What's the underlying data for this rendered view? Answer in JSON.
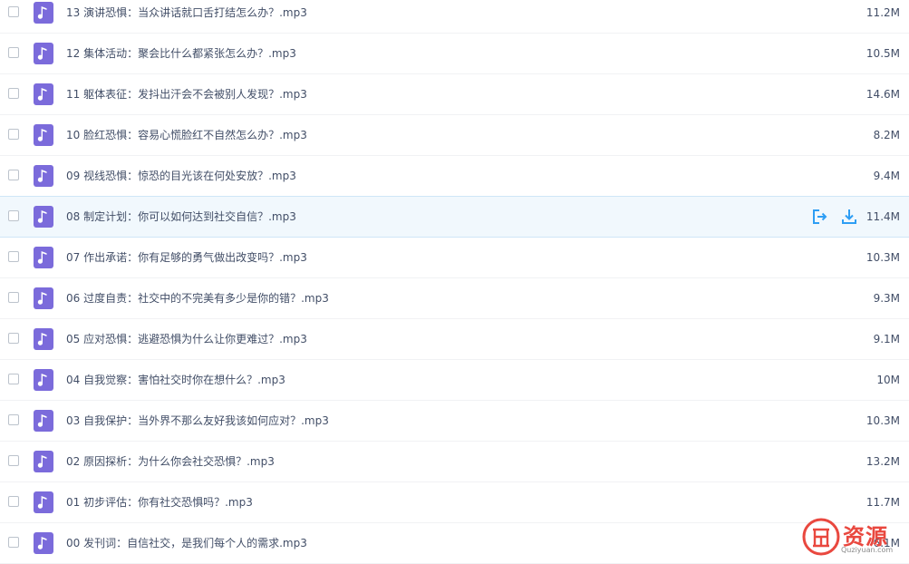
{
  "files": [
    {
      "name": "13 演讲恐惧：当众讲话就口舌打结怎么办？.mp3",
      "size": "11.2M",
      "icon": "music-note-icon"
    },
    {
      "name": "12 集体活动：聚会比什么都紧张怎么办？.mp3",
      "size": "10.5M",
      "icon": "music-note-icon"
    },
    {
      "name": "11 躯体表征：发抖出汗会不会被别人发现？.mp3",
      "size": "14.6M",
      "icon": "music-note-icon"
    },
    {
      "name": "10 脸红恐惧：容易心慌脸红不自然怎么办？.mp3",
      "size": "8.2M",
      "icon": "music-note-icon"
    },
    {
      "name": "09 视线恐惧：惊恐的目光该在何处安放？.mp3",
      "size": "9.4M",
      "icon": "music-note-icon"
    },
    {
      "name": "08 制定计划：你可以如何达到社交自信？.mp3",
      "size": "11.4M",
      "icon": "music-note-icon",
      "hovered": true
    },
    {
      "name": "07 作出承诺：你有足够的勇气做出改变吗？.mp3",
      "size": "10.3M",
      "icon": "music-note-icon"
    },
    {
      "name": "06 过度自责：社交中的不完美有多少是你的错？.mp3",
      "size": "9.3M",
      "icon": "music-note-icon"
    },
    {
      "name": "05 应对恐惧：逃避恐惧为什么让你更难过？.mp3",
      "size": "9.1M",
      "icon": "music-note-icon"
    },
    {
      "name": "04 自我觉察：害怕社交时你在想什么？.mp3",
      "size": "10M",
      "icon": "music-note-icon"
    },
    {
      "name": "03 自我保护：当外界不那么友好我该如何应对？.mp3",
      "size": "10.3M",
      "icon": "music-note-icon"
    },
    {
      "name": "02 原因探析：为什么你会社交恐惧？.mp3",
      "size": "13.2M",
      "icon": "music-note-icon"
    },
    {
      "name": "01 初步评估：你有社交恐惧吗？.mp3",
      "size": "11.7M",
      "icon": "music-note-icon"
    },
    {
      "name": "00 发刊词：自信社交，是我们每个人的需求.mp3",
      "size": "6.1M",
      "icon": "music-note-icon"
    }
  ],
  "row_actions": {
    "share_icon": "share-icon",
    "download_icon": "download-icon"
  },
  "watermark": {
    "text": "资源",
    "domain": "Quziyuan.com"
  },
  "colors": {
    "icon_bg": "#7b6bdb",
    "text": "#424e67",
    "hover_bg": "#f1f8fd",
    "action_blue": "#2e9ef4",
    "watermark_red": "#e9483f"
  }
}
